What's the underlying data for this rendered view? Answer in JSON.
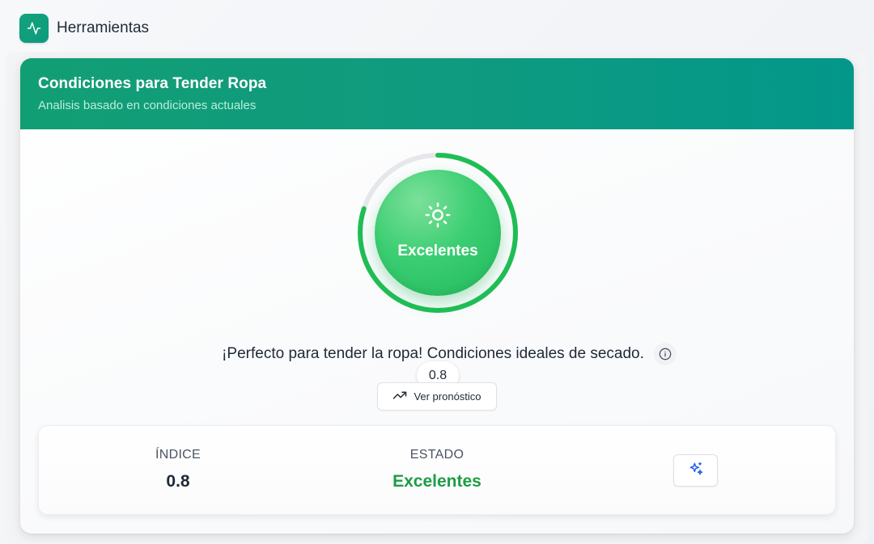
{
  "app": {
    "title": "Herramientas",
    "icon": "activity-icon",
    "accent": "#13a37b"
  },
  "card": {
    "title": "Condiciones para Tender Ropa",
    "subtitle": "Analisis basado en condiciones actuales",
    "header_color_start": "#129e74",
    "header_color_end": "#03978a"
  },
  "gauge": {
    "icon": "sun-icon",
    "label": "Excelentes",
    "score": "0.8",
    "progress": 0.8,
    "color": "#21b85c"
  },
  "message": {
    "text": "¡Perfecto para tender la ropa! Condiciones ideales de secado.",
    "info_icon": "info-icon"
  },
  "forecast_button": {
    "label": "Ver pronóstico",
    "icon": "trending-up-icon"
  },
  "stats": {
    "index_label": "ÍNDICE",
    "index_value": "0.8",
    "state_label": "ESTADO",
    "state_value": "Excelentes",
    "state_color": "#1f9d46",
    "action_icon": "sparkles-icon"
  }
}
